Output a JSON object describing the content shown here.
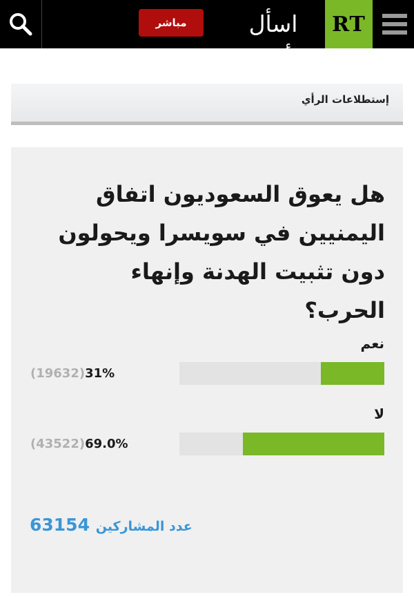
{
  "header": {
    "live_label": "مباشر",
    "slogan": "اسأل أكثر",
    "logo_text": "RT",
    "search_icon": "search-icon",
    "menu_icon": "hamburger-menu-icon"
  },
  "section": {
    "title": "إستطلاعات الرأي"
  },
  "poll": {
    "question": "هل يعوق السعوديون اتفاق اليمنيين في سويسرا ويحولون دون تثبيت الهدنة وإنهاء الحرب؟",
    "options": [
      {
        "label": "نعم",
        "count_text": "(19632)",
        "percent_text": "31%",
        "percent": 31
      },
      {
        "label": "لا",
        "count_text": "(43522)",
        "percent_text": "69.0%",
        "percent": 69
      }
    ],
    "participants_label": "عدد المشاركين",
    "participants_count": "63154"
  },
  "colors": {
    "accent_green": "#7ab828",
    "live_red": "#b00d0d",
    "link_blue": "#3a96d6"
  }
}
